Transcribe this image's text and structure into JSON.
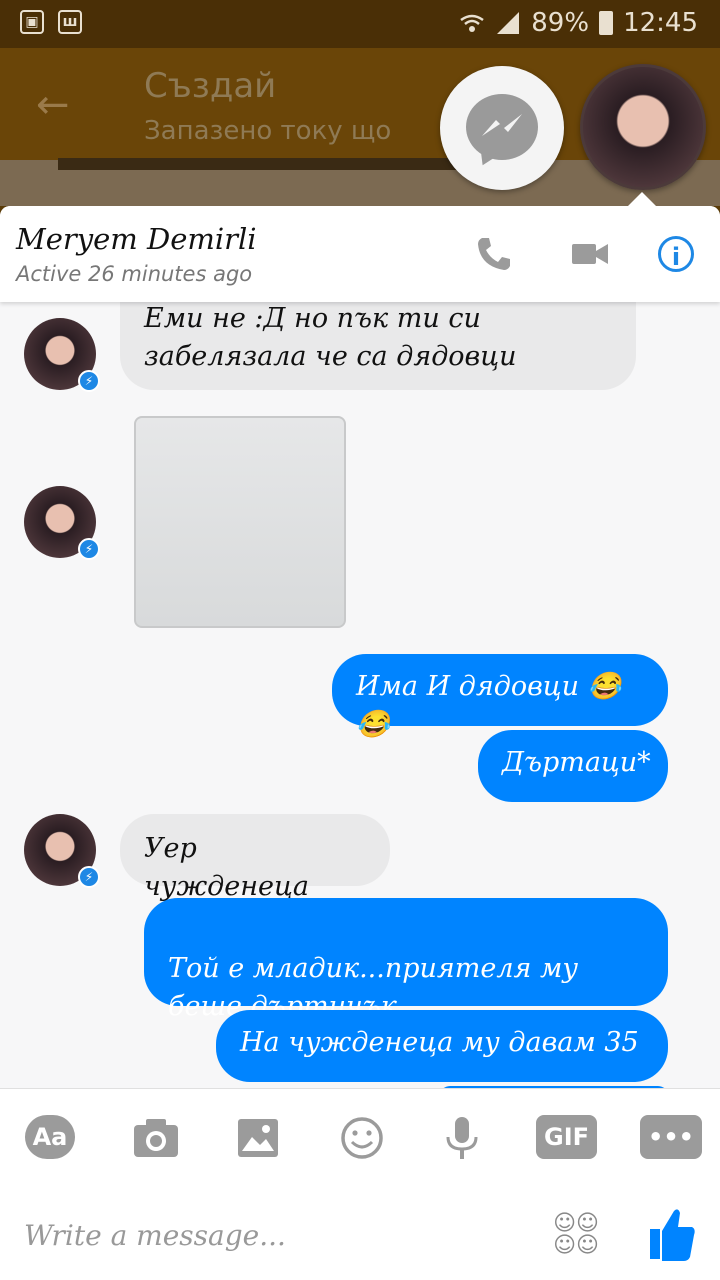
{
  "status_bar": {
    "battery": "89%",
    "time": "12:45",
    "left_icons": [
      "image-icon",
      "app-icon"
    ]
  },
  "background_app": {
    "title": "Създай",
    "subtitle": "Запазено току що"
  },
  "chat": {
    "contact_name": "Meryem Demirli",
    "status": "Active 26 minutes ago",
    "messages": [
      {
        "from": "them",
        "text": "Еми не :Д но пък ти си\nзабелязала че са дядовци"
      },
      {
        "from": "them",
        "type": "photo"
      },
      {
        "from": "me",
        "text": "Има И дядовци 😂😂"
      },
      {
        "from": "me",
        "text": "Дъртаци*"
      },
      {
        "from": "them",
        "text": "Уер чужденеца"
      },
      {
        "from": "me",
        "text": "Той е младик...приятеля му\nбеше дъртичък"
      },
      {
        "from": "me",
        "text": "На чужденеца му давам 35"
      }
    ]
  },
  "composer": {
    "placeholder": "Write a message...",
    "text_tool": "Aa",
    "gif_label": "GIF"
  },
  "colors": {
    "outgoing": "#0084ff",
    "incoming": "#e9e9ea",
    "accent": "#1e88e5"
  }
}
